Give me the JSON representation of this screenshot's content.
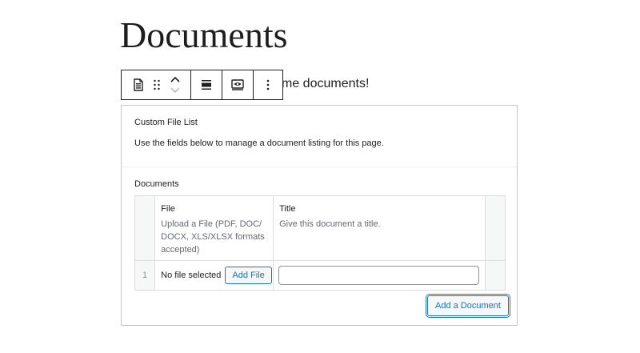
{
  "page": {
    "title": "Documents",
    "intro_visible_text": "me documents!"
  },
  "toolbar": {
    "icons": [
      "document-block-icon",
      "drag-handle-icon",
      "move-up-icon",
      "move-down-icon",
      "align-icon",
      "visibility-icon",
      "more-options-icon"
    ]
  },
  "meta_box": {
    "title": "Custom File List",
    "description": "Use the fields below to manage a document listing for this page.",
    "field_label": "Documents",
    "columns": [
      {
        "label": "File",
        "instructions": "Upload a File (PDF, DOC/ DOCX, XLS/XLSX formats accepted)"
      },
      {
        "label": "Title",
        "instructions": "Give this document a title."
      }
    ],
    "rows": [
      {
        "order": "1",
        "file_status": "No file selected",
        "add_file_label": "Add File",
        "title_value": ""
      }
    ],
    "add_row_label": "Add a Document"
  },
  "colors": {
    "accent": "#2271b1",
    "border": "#dcdcde",
    "muted_text": "#646970"
  }
}
